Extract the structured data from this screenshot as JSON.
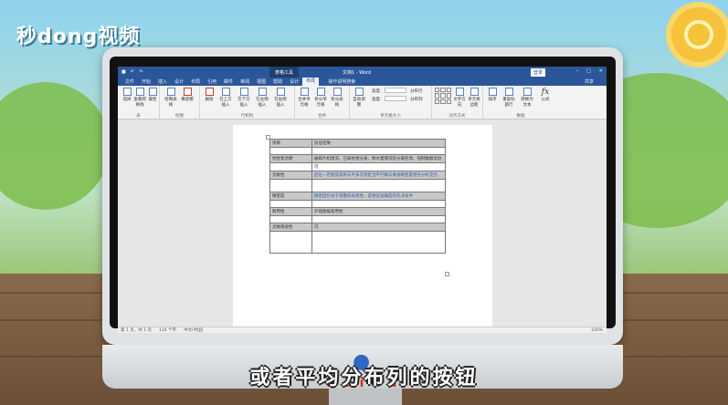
{
  "logo": {
    "text": "秒dong视频"
  },
  "subtitle": "或者平均分布列的按钮",
  "brand": {
    "text": "Baidu"
  },
  "word": {
    "context_title": "表格工具",
    "doc_title": "文档1 - Word",
    "login": "登录",
    "tabs": [
      "文件",
      "开始",
      "插入",
      "设计",
      "布局",
      "引用",
      "邮件",
      "审阅",
      "视图",
      "帮助",
      "设计",
      "布局"
    ],
    "tell_me": "操作说明搜索",
    "share": "共享",
    "ribbon": {
      "groups": [
        "表",
        "绘图",
        "行和列",
        "合并",
        "单元格大小",
        "对齐方式",
        "数据"
      ],
      "buttons": [
        "选择",
        "查看网格线",
        "属性",
        "绘制表格",
        "橡皮擦",
        "删除",
        "在上方插入",
        "在下方插入",
        "在左侧插入",
        "在右侧插入",
        "合并单元格",
        "拆分单元格",
        "拆分表格",
        "自动调整",
        "文字方向",
        "单元格边距",
        "排序",
        "重复标题行",
        "转换为文本",
        "公式"
      ],
      "height_label": "高度:",
      "width_label": "宽度:",
      "dist_rows": "分布行",
      "dist_cols": "分布列"
    },
    "table": [
      [
        "项目",
        "验证结果"
      ],
      [
        "",
        ""
      ],
      [
        "抗性和坚硬",
        "破碎片机情况、已知抗感分离、降水量情况检分离检测、强制酶解试验"
      ],
      [
        "",
        "可"
      ],
      [
        "",
        ""
      ],
      [
        "灵敏性",
        "后位一定能提高所与不多次测定当平行精与真值精密度相合分析是否、"
      ],
      [
        "",
        ""
      ],
      [
        "精密度",
        "精密度包含于测量的再现性，是保证准确度的先决条件"
      ],
      [
        "",
        ""
      ],
      [
        "耐用性",
        "外观图纸耐用性"
      ],
      [
        "",
        ""
      ],
      [
        "灵敏限值性",
        "可"
      ],
      [
        "",
        ""
      ],
      [
        "",
        ""
      ]
    ],
    "status": {
      "page": "第 1 页，共 1 页",
      "words": "114 个字",
      "lang": "中文(中国)",
      "zoom": "100%"
    }
  }
}
